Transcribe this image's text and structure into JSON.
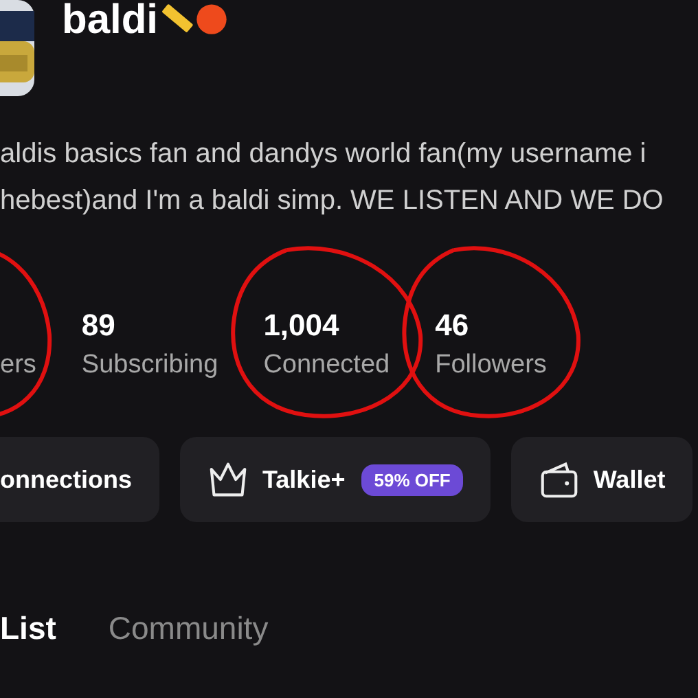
{
  "profile": {
    "name": "baldi",
    "bio": [
      "aldis basics fan and dandys world fan(my username i",
      "hebest)and I'm a baldi simp. WE LISTEN AND WE DO"
    ]
  },
  "stats": [
    {
      "label": "ers",
      "circled": true
    },
    {
      "number": "89",
      "label": "Subscribing",
      "circled": false
    },
    {
      "number": "1,004",
      "label": "Connected",
      "circled": true
    },
    {
      "number": "46",
      "label": "Followers",
      "circled": true
    }
  ],
  "actions": [
    {
      "kind": "plain",
      "label": "onnections"
    },
    {
      "kind": "crown",
      "label": "Talkie+",
      "badge": "59% OFF"
    },
    {
      "kind": "wallet",
      "label": "Wallet"
    }
  ],
  "tabs": [
    {
      "label": "List",
      "selected": true
    },
    {
      "label": "Community",
      "selected": false
    }
  ]
}
